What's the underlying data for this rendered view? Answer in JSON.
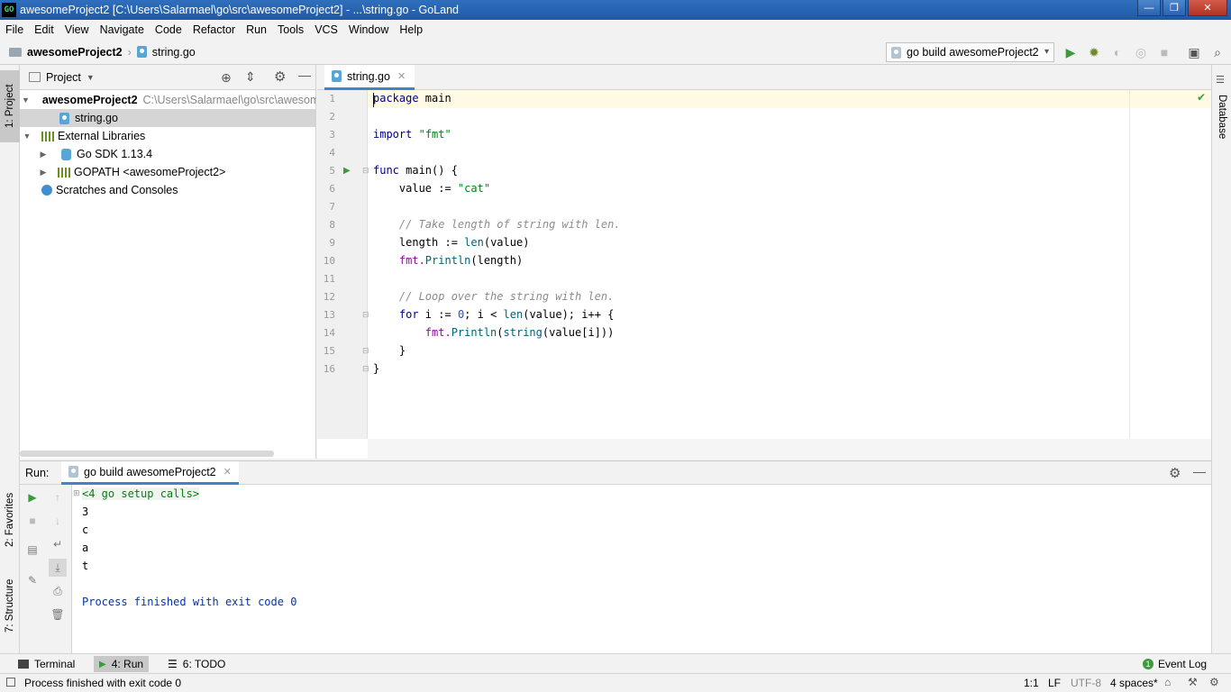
{
  "window": {
    "title": "awesomeProject2 [C:\\Users\\Salarmael\\go\\src\\awesomeProject2] - ...\\string.go - GoLand",
    "app_icon_text": "GO",
    "controls": {
      "minimize": "—",
      "maximize": "❐",
      "close": "✕"
    }
  },
  "menu": [
    "File",
    "Edit",
    "View",
    "Navigate",
    "Code",
    "Refactor",
    "Run",
    "Tools",
    "VCS",
    "Window",
    "Help"
  ],
  "navbar": {
    "breadcrumb": [
      "awesomeProject2",
      "string.go"
    ],
    "run_config": "go build awesomeProject2"
  },
  "left_strip": {
    "project_tab": "1: Project",
    "favorites_tab": "2: Favorites",
    "structure_tab": "7: Structure"
  },
  "right_strip": {
    "database_tab": "Database"
  },
  "project_panel": {
    "title": "Project",
    "tree": {
      "root_name": "awesomeProject2",
      "root_path": "C:\\Users\\Salarmael\\go\\src\\awesom",
      "file": "string.go",
      "external_libraries": "External Libraries",
      "go_sdk": "Go SDK 1.13.4",
      "gopath": "GOPATH <awesomeProject2>",
      "scratches": "Scratches and Consoles"
    }
  },
  "editor": {
    "tab_label": "string.go",
    "line_numbers": [
      "1",
      "2",
      "3",
      "4",
      "5",
      "6",
      "7",
      "8",
      "9",
      "10",
      "11",
      "12",
      "13",
      "14",
      "15",
      "16"
    ],
    "code": {
      "l1_kw": "package",
      "l1_rest": " main",
      "l3_kw": "import",
      "l3_str": "\"fmt\"",
      "l5_kw": "func",
      "l5_rest": " main() {",
      "l6_a": "    value := ",
      "l6_str": "\"cat\"",
      "l8_cmt": "    // Take length of string with len.",
      "l9_a": "    length := ",
      "l9_fn": "len",
      "l9_b": "(value)",
      "l10_pkg": "    fmt.",
      "l10_fn": "Println",
      "l10_b": "(length)",
      "l12_cmt": "    // Loop over the string with len.",
      "l13_kw": "    for",
      "l13_a": " i := ",
      "l13_num": "0",
      "l13_b": "; i < ",
      "l13_fn": "len",
      "l13_c": "(value); i++ {",
      "l14_pkg": "        fmt.",
      "l14_fn": "Println",
      "l14_b": "(",
      "l14_fn2": "string",
      "l14_c": "(value[i]))",
      "l15": "    }",
      "l16": "}"
    }
  },
  "run_panel": {
    "label": "Run:",
    "tab": "go build awesomeProject2",
    "output": {
      "setup": "<4 go setup calls>",
      "lines": [
        "3",
        "c",
        "a",
        "t"
      ],
      "finished": "Process finished with exit code 0"
    }
  },
  "tool_windows": {
    "terminal": "Terminal",
    "run": "4: Run",
    "todo": "6: TODO",
    "event_log": "Event Log",
    "event_count": "1"
  },
  "status_bar": {
    "message": "Process finished with exit code 0",
    "position": "1:1",
    "line_sep": "LF",
    "encoding": "UTF-8",
    "indent": "4 spaces*"
  },
  "colors": {
    "accent": "#4083c9",
    "run_green": "#3c9a3c",
    "titlebar": "#2f6fbd"
  }
}
